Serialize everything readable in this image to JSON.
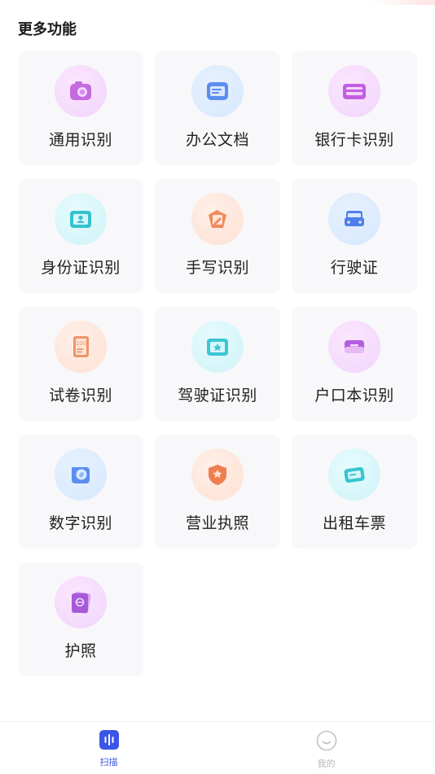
{
  "section_title": "更多功能",
  "features": [
    {
      "label": "通用识别",
      "icon": "camera-icon",
      "theme": "purple"
    },
    {
      "label": "办公文档",
      "icon": "document-icon",
      "theme": "blue"
    },
    {
      "label": "银行卡识别",
      "icon": "bank-card-icon",
      "theme": "purple"
    },
    {
      "label": "身份证识别",
      "icon": "id-card-icon",
      "theme": "cyan"
    },
    {
      "label": "手写识别",
      "icon": "handwriting-icon",
      "theme": "orange"
    },
    {
      "label": "行驶证",
      "icon": "car-icon",
      "theme": "blue"
    },
    {
      "label": "试卷识别",
      "icon": "exam-paper-icon",
      "theme": "orange"
    },
    {
      "label": "驾驶证识别",
      "icon": "driver-license-icon",
      "theme": "cyan"
    },
    {
      "label": "户口本识别",
      "icon": "household-register-icon",
      "theme": "purple"
    },
    {
      "label": "数字识别",
      "icon": "number-icon",
      "theme": "blue"
    },
    {
      "label": "营业执照",
      "icon": "business-license-icon",
      "theme": "orange"
    },
    {
      "label": "出租车票",
      "icon": "taxi-ticket-icon",
      "theme": "cyan"
    },
    {
      "label": "护照",
      "icon": "passport-icon",
      "theme": "purple"
    }
  ],
  "tabs": [
    {
      "label": "扫描",
      "icon": "scan-icon",
      "active": true
    },
    {
      "label": "我的",
      "icon": "profile-icon",
      "active": false
    }
  ],
  "colors": {
    "accent": "#3b56e6",
    "tile_background": "#f8f8fa",
    "inactive_tab": "#b8b8b8"
  }
}
